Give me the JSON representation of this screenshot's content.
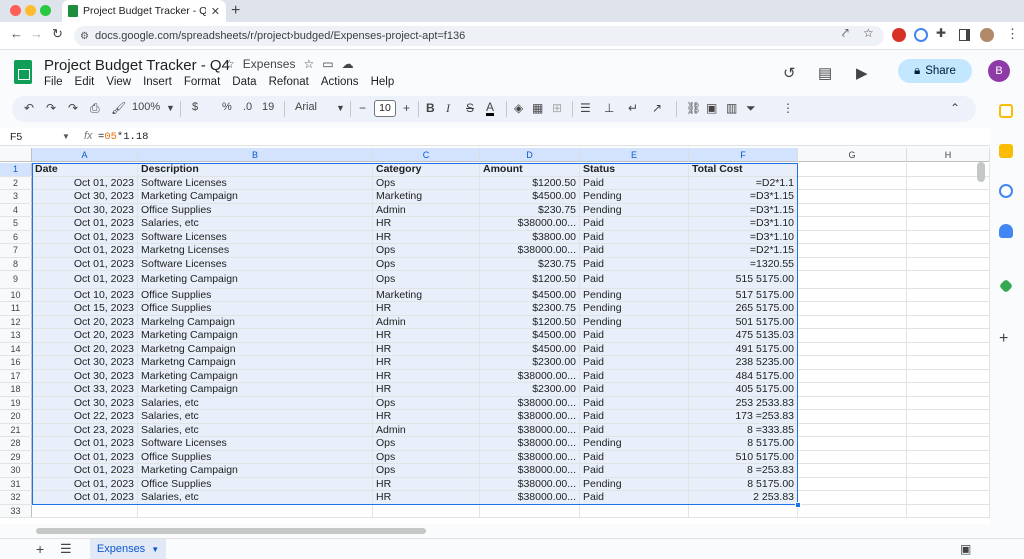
{
  "browser": {
    "tab_title": "Project Budget Tracker - Q4",
    "tab_close": "✕",
    "new_tab": "+",
    "url": "docs.google.com/spreadsheets/r/project›budged/Expenses-project-apt=f136"
  },
  "sheet": {
    "title": "Project Budget Tracker - Q4",
    "folder_label": "Expenses",
    "menu": [
      "File",
      "Edit",
      "View",
      "Insert",
      "Format",
      "Data",
      "Refonat",
      "Actions",
      "Help"
    ],
    "share_label": "Share",
    "avatar_letter": "B"
  },
  "toolbar": {
    "zoom": "100%",
    "currency": "$",
    "percent": "%",
    "decimals": ".0",
    "more_formats": "19",
    "font": "Arial",
    "font_size": "10",
    "bold": "B",
    "italic": "I",
    "strike": "S",
    "text_color": "A"
  },
  "formula_bar": {
    "name_box": "F5",
    "fx": "fx",
    "formula_prefix": "=",
    "formula_ref": "05",
    "formula_rest": "*1.18"
  },
  "columns": [
    "A",
    "B",
    "C",
    "D",
    "E",
    "F",
    "G",
    "H"
  ],
  "table": {
    "headers": [
      "Date",
      "Description",
      "Category",
      "Amount",
      "Status",
      "Total Cost"
    ],
    "rows": [
      {
        "n": "2",
        "date": "Oct 01, 2023",
        "desc": "Software Licenses",
        "cat": "Ops",
        "amt": "$1200.50",
        "status": "Paid",
        "total": "=D2*1.1"
      },
      {
        "n": "3",
        "date": "Oct 30, 2023",
        "desc": "Marketing Campaign",
        "cat": "Marketing",
        "amt": "$4500.00",
        "status": "Pending",
        "total": "=D3*1.15"
      },
      {
        "n": "4",
        "date": "Oct 30, 2023",
        "desc": "Office Supplies",
        "cat": "Admin",
        "amt": "$230.75",
        "status": "Pending",
        "total": "=D3*1.15"
      },
      {
        "n": "5",
        "date": "Oct 01, 2023",
        "desc": "Salaries, etc",
        "cat": "HR",
        "amt": "$38000.00...",
        "status": "Paid",
        "total": "=D3*1.10"
      },
      {
        "n": "6",
        "date": "Oct 01, 2023",
        "desc": "Software Licenses",
        "cat": "HR",
        "amt": "$3800.00",
        "status": "Paid",
        "total": "=D3*1.10"
      },
      {
        "n": "7",
        "date": "Oct 01, 2023",
        "desc": "Marketng Licenses",
        "cat": "Ops",
        "amt": "$38000.00...",
        "status": "Paid",
        "total": "=D2*1.15"
      },
      {
        "n": "8",
        "date": "Oct 01, 2023",
        "desc": "Software Licenses",
        "cat": "Ops",
        "amt": "$230.75",
        "status": "Paid",
        "total": "=1320.55"
      },
      {
        "n": "9",
        "date": "Oct 01, 2023",
        "desc": "Marketing Campaign",
        "cat": "Ops",
        "amt": "$1200.50",
        "status": "Paid",
        "total": "515 5175.00"
      },
      {
        "n": "10",
        "date": "Oct 10, 2023",
        "desc": "Office Supplies",
        "cat": "Marketing",
        "amt": "$4500.00",
        "status": "Pending",
        "total": "517 5175.00"
      },
      {
        "n": "11",
        "date": "Oct 15, 2023",
        "desc": "Office Supplies",
        "cat": "HR",
        "amt": "$2300.75",
        "status": "Pending",
        "total": "265 5175.00"
      },
      {
        "n": "12",
        "date": "Oct 20, 2023",
        "desc": "Markelng Campaign",
        "cat": "Admin",
        "amt": "$1200.50",
        "status": "Pending",
        "total": "501 5175.00"
      },
      {
        "n": "13",
        "date": "Oct 20, 2023",
        "desc": "Marketing Campaign",
        "cat": "HR",
        "amt": "$4500.00",
        "status": "Paid",
        "total": "475 5135.03"
      },
      {
        "n": "14",
        "date": "Oct 20, 2023",
        "desc": "Marketng Campaign",
        "cat": "HR",
        "amt": "$4500.00",
        "status": "Paid",
        "total": "491 5175.00"
      },
      {
        "n": "16",
        "date": "Oct 30, 2023",
        "desc": "Marketng Campaign",
        "cat": "HR",
        "amt": "$2300.00",
        "status": "Paid",
        "total": "238 5235.00"
      },
      {
        "n": "17",
        "date": "Oct 30, 2023",
        "desc": "Marketing Campaign",
        "cat": "HR",
        "amt": "$38000.00...",
        "status": "Paid",
        "total": "484 5175.00"
      },
      {
        "n": "18",
        "date": "Oct 33, 2023",
        "desc": "Marketing Campaign",
        "cat": "HR",
        "amt": "$2300.00",
        "status": "Paid",
        "total": "405 5175.00"
      },
      {
        "n": "19",
        "date": "Oct 30, 2023",
        "desc": "Salaries, etc",
        "cat": "Ops",
        "amt": "$38000.00...",
        "status": "Paid",
        "total": "253 2533.83"
      },
      {
        "n": "20",
        "date": "Oct 22, 2023",
        "desc": "Salaries, etc",
        "cat": "HR",
        "amt": "$38000.00...",
        "status": "Paid",
        "total": "173 =253.83"
      },
      {
        "n": "21",
        "date": "Oct 23, 2023",
        "desc": "Salaries, etc",
        "cat": "Admin",
        "amt": "$38000.00...",
        "status": "Paid",
        "total": "8 =333.85"
      },
      {
        "n": "28",
        "date": "Oct 01, 2023",
        "desc": "Software Licenses",
        "cat": "Ops",
        "amt": "$38000.00...",
        "status": "Pending",
        "total": "8 5175.00"
      },
      {
        "n": "29",
        "date": "Oct 01, 2023",
        "desc": "Office Supplies",
        "cat": "Ops",
        "amt": "$38000.00...",
        "status": "Paid",
        "total": "510 5175.00"
      },
      {
        "n": "30",
        "date": "Oct 01, 2023",
        "desc": "Marketing Campaign",
        "cat": "Ops",
        "amt": "$38000.00...",
        "status": "Paid",
        "total": "8 =253.83"
      },
      {
        "n": "31",
        "date": "Oct 01, 2023",
        "desc": "Office Supplies",
        "cat": "HR",
        "amt": "$38000.00...",
        "status": "Pending",
        "total": "8 5175.00"
      },
      {
        "n": "32",
        "date": "Oct 01, 2023",
        "desc": "Salaries, etc",
        "cat": "HR",
        "amt": "$38000.00...",
        "status": "Paid",
        "total": "2   253.83"
      }
    ],
    "empty_row": "33"
  },
  "bottom": {
    "sheet_tab": "Expenses"
  },
  "icons": {
    "tab_favicon": "sheets-icon",
    "star": "☆",
    "share_icon": "lock-icon"
  }
}
